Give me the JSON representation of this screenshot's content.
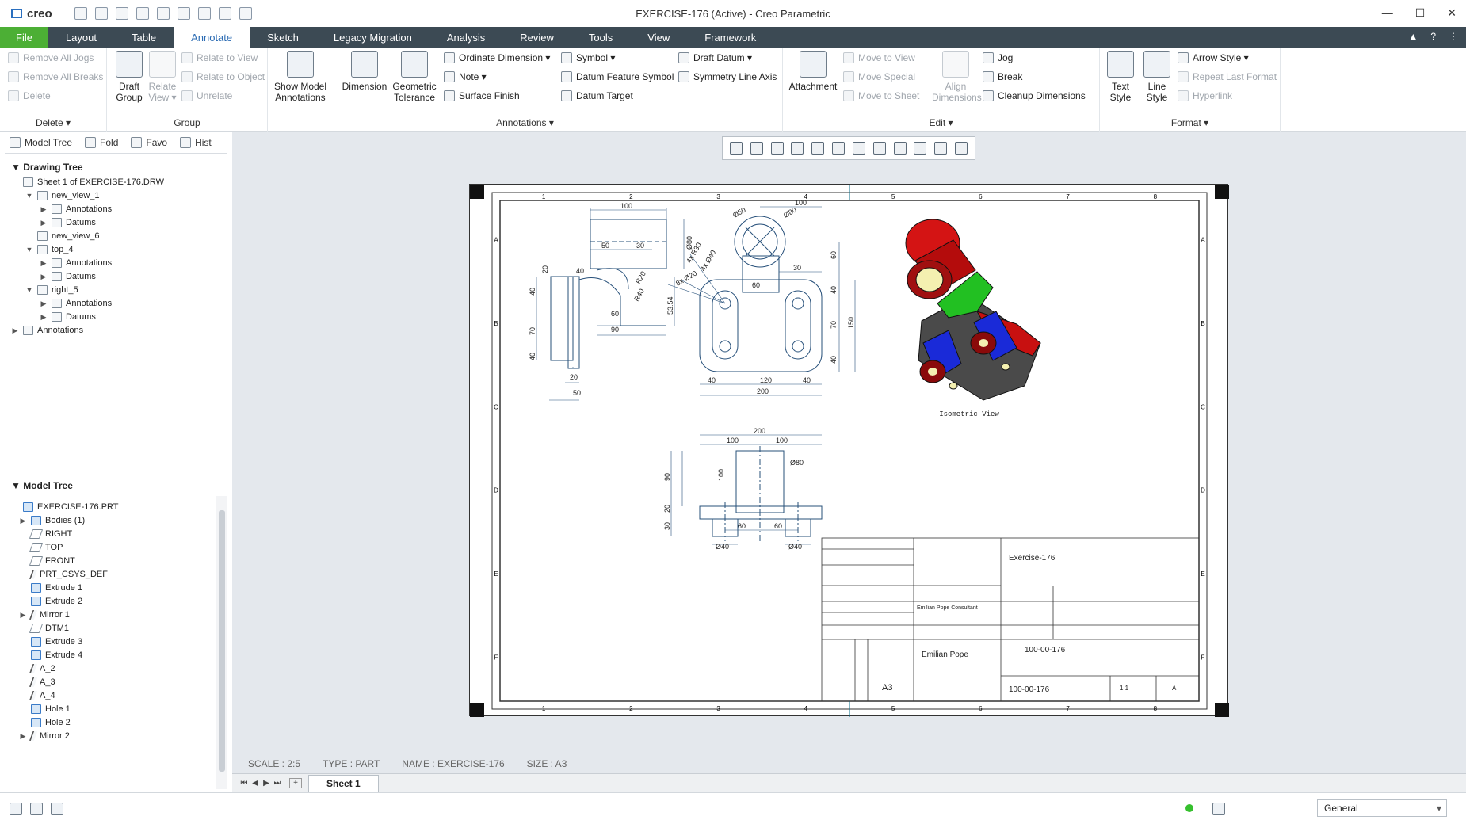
{
  "app": {
    "logo": "creo",
    "title": "EXERCISE-176 (Active) - Creo Parametric"
  },
  "menu": {
    "tabs": [
      "File",
      "Layout",
      "Table",
      "Annotate",
      "Sketch",
      "Legacy Migration",
      "Analysis",
      "Review",
      "Tools",
      "View",
      "Framework"
    ],
    "active": "Annotate"
  },
  "ribbon": {
    "delete": {
      "items": [
        "Remove All Jogs",
        "Remove All Breaks",
        "Delete"
      ],
      "label": "Delete ▾"
    },
    "group": {
      "draft_group": "Draft Group",
      "relate_view": "Relate View ▾",
      "items": [
        "Relate to View",
        "Relate to Object",
        "Unrelate"
      ],
      "label": "Group"
    },
    "annotations": {
      "show_model": "Show Model Annotations",
      "dimension": "Dimension",
      "geom_tol": "Geometric Tolerance",
      "ordinate": "Ordinate Dimension ▾",
      "note": "Note ▾",
      "surface_finish": "Surface Finish",
      "symbol": "Symbol ▾",
      "datum_feature": "Datum Feature Symbol",
      "datum_target": "Datum Target",
      "draft_datum": "Draft Datum ▾",
      "symmetry": "Symmetry Line Axis",
      "label": "Annotations ▾"
    },
    "edit": {
      "attachment": "Attachment",
      "move_to_view": "Move to View",
      "move_special": "Move Special",
      "move_to_sheet": "Move to Sheet",
      "align_dims": "Align Dimensions",
      "jog": "Jog",
      "break": "Break",
      "cleanup": "Cleanup Dimensions",
      "label": "Edit ▾"
    },
    "format": {
      "text_style": "Text Style",
      "line_style": "Line Style",
      "arrow_style": "Arrow Style ▾",
      "repeat": "Repeat Last Format",
      "hyperlink": "Hyperlink",
      "label": "Format ▾"
    }
  },
  "leftpanel": {
    "tabs": [
      "Model Tree",
      "Fold",
      "Favo",
      "Hist"
    ],
    "drawing_tree_title": "Drawing Tree",
    "drawing_tree": [
      "Sheet 1 of EXERCISE-176.DRW",
      "new_view_1",
      "Annotations",
      "Datums",
      "new_view_6",
      "top_4",
      "Annotations",
      "Datums",
      "right_5",
      "Annotations",
      "Datums",
      "Annotations"
    ],
    "model_tree_title": "Model Tree",
    "model_tree": [
      "EXERCISE-176.PRT",
      "Bodies (1)",
      "RIGHT",
      "TOP",
      "FRONT",
      "PRT_CSYS_DEF",
      "Extrude 1",
      "Extrude 2",
      "Mirror 1",
      "DTM1",
      "Extrude 3",
      "Extrude 4",
      "A_2",
      "A_3",
      "A_4",
      "Hole 1",
      "Hole 2",
      "Mirror 2"
    ]
  },
  "drawing": {
    "iso_label": "Isometric View",
    "zone_cols": [
      "1",
      "2",
      "3",
      "4",
      "5",
      "6",
      "7",
      "8"
    ],
    "zone_rows": [
      "A",
      "B",
      "C",
      "D",
      "E",
      "F"
    ],
    "dims_front": [
      "100",
      "50",
      "30",
      "Ø80",
      "20",
      "40",
      "R20",
      "R40",
      "40",
      "70",
      "40",
      "60",
      "90",
      "53.54",
      "20",
      "50"
    ],
    "dims_top": [
      "Ø50",
      "Ø80",
      "100",
      "30",
      "60",
      "4x R30",
      "4x Ø40",
      "8x Ø20",
      "60",
      "40",
      "70",
      "150",
      "40",
      "40",
      "120",
      "40",
      "200"
    ],
    "dims_bottom": [
      "200",
      "100",
      "100",
      "Ø80",
      "90",
      "100",
      "20",
      "30",
      "60",
      "60",
      "Ø40",
      "Ø40"
    ],
    "title_block": {
      "title": "Exercise-176",
      "part_no": "100-00-176",
      "drawing_no": "100-00-176",
      "author": "Emilian Pope",
      "size": "A3",
      "scale": "1:1",
      "rev": "A",
      "company": "Emilian Pope Consultant"
    }
  },
  "status": {
    "scale": "SCALE : 2:5",
    "type": "TYPE : PART",
    "name": "NAME : EXERCISE-176",
    "size": "SIZE : A3"
  },
  "sheet_tab": "Sheet 1",
  "filter": "General"
}
